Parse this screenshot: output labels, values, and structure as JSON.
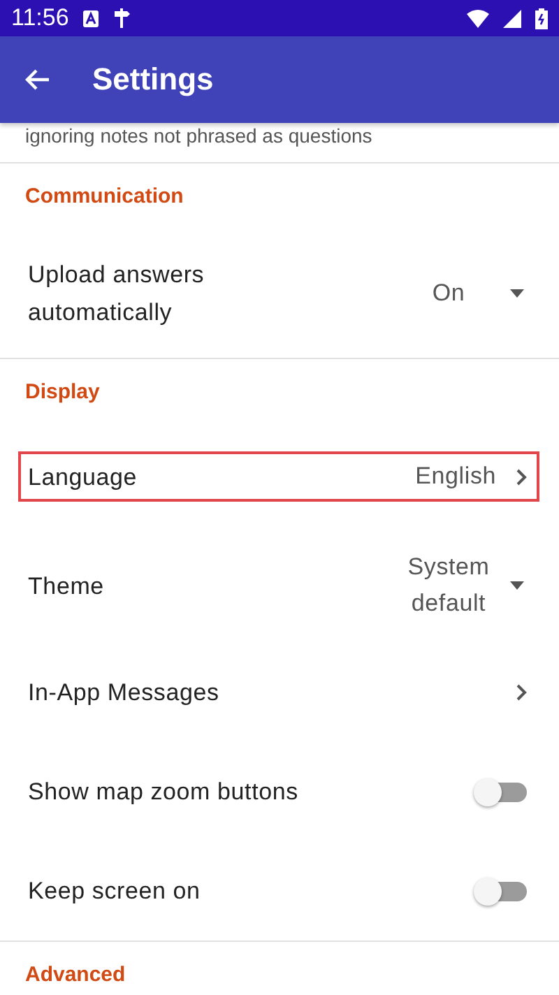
{
  "status_bar": {
    "time": "11:56"
  },
  "app_bar": {
    "title": "Settings"
  },
  "cut_text": "ignoring notes not phrased as questions",
  "sections": [
    {
      "title": "Communication",
      "items": [
        {
          "kind": "dropdown",
          "label": "Upload answers automatically",
          "value": "On",
          "highlighted": false
        }
      ]
    },
    {
      "title": "Display",
      "items": [
        {
          "kind": "link",
          "label": "Language",
          "value": "English",
          "highlighted": true
        },
        {
          "kind": "dropdown",
          "label": "Theme",
          "value": "System default",
          "highlighted": false
        },
        {
          "kind": "link",
          "label": "In-App Messages",
          "highlighted": false
        },
        {
          "kind": "toggle",
          "label": "Show map zoom buttons",
          "on": false,
          "highlighted": false
        },
        {
          "kind": "toggle",
          "label": "Keep screen on",
          "on": false,
          "highlighted": false
        }
      ]
    },
    {
      "title": "Advanced"
    }
  ]
}
